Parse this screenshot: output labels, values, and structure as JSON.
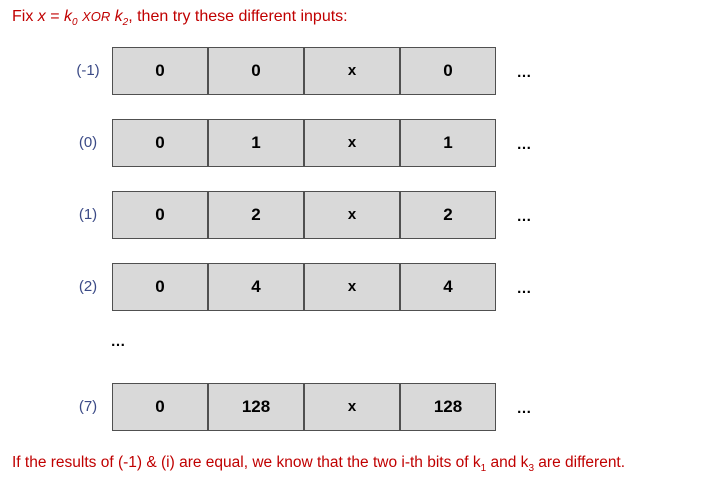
{
  "title": {
    "prefix": "Fix ",
    "var_x": "x",
    "equals": " = ",
    "k0_letter": "k",
    "k0_sub": "0",
    "xor": "XOR",
    "k2_letter": "k",
    "k2_sub": "2",
    "suffix": ", then try these different inputs:"
  },
  "rows": [
    {
      "label": "(-1)",
      "cells": [
        "0",
        "0",
        "x",
        "0"
      ],
      "ellipsis": "…"
    },
    {
      "label": "(0)",
      "cells": [
        "0",
        "1",
        "x",
        "1"
      ],
      "ellipsis": "…"
    },
    {
      "label": "(1)",
      "cells": [
        "0",
        "2",
        "x",
        "2"
      ],
      "ellipsis": "…"
    },
    {
      "label": "(2)",
      "cells": [
        "0",
        "4",
        "x",
        "4"
      ],
      "ellipsis": "…"
    },
    {
      "label": "(7)",
      "cells": [
        "0",
        "128",
        "x",
        "128"
      ],
      "ellipsis": "…"
    }
  ],
  "middle_ellipsis": "…",
  "footer": {
    "part1": "If the results of (-1) & (i) are equal, we know that the two i-th bits of k",
    "k1_sub": "1",
    "part2": " and k",
    "k3_sub": "3",
    "part3": " are different."
  },
  "colors": {
    "text_red": "#c00000",
    "label_blue": "#3b4a86",
    "cell_fill": "#d9d9d9",
    "cell_border": "#505050"
  }
}
